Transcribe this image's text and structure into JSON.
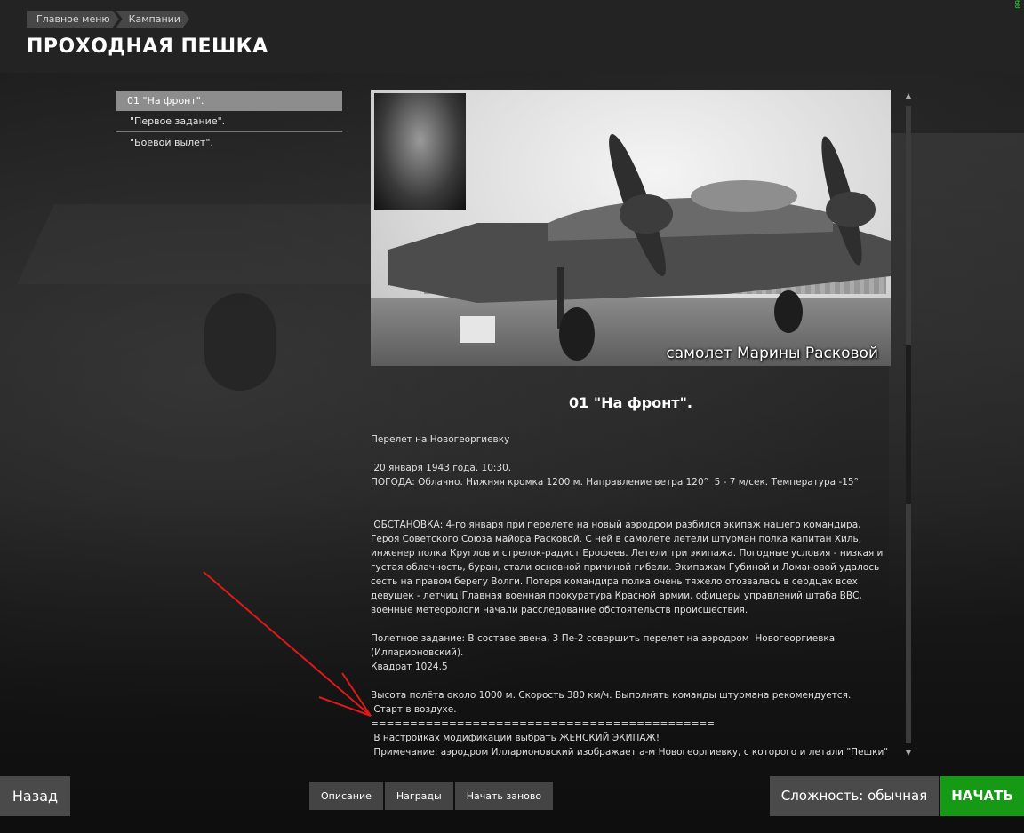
{
  "breadcrumb": [
    "Главное меню",
    "Кампании"
  ],
  "page_title": "ПРОХОДНАЯ ПЕШКА",
  "fps_counter": "60",
  "missions": [
    {
      "label": "01 \"На фронт\".",
      "active": true
    },
    {
      "label": "\"Первое задание\".",
      "active": false
    },
    {
      "label": "\"Боевой вылет\".",
      "active": false
    }
  ],
  "photo": {
    "caption": "самолет Марины Расковой"
  },
  "mission_heading": "01 \"На фронт\".",
  "description": [
    "Перелет на Новогеоргиевку",
    "",
    " 20 января 1943 года. 10:30.\nПОГОДА: Облачно. Нижняя кромка 1200 м. Направление ветра 120°  5 - 7 м/сек. Температура -15°",
    "",
    "",
    " ОБСТАНОВКА: 4-го января при перелете на новый аэродром разбился экипаж нашего командира, Героя Советского Союза майора Расковой. С ней в самолете летели штурман полка капитан Хиль, инженер полка Круглов и стрелок-радист Ерофеев. Летели три экипажа. Погодные условия - низкая и густая облачность, буран, стали основной причиной гибели. Экипажам Губиной и Ломановой удалось сесть на правом берегу Волги. Потеря командира полка очень тяжело отозвалась в сердцах всех девушек - летчиц!Главная военная прокуратура Красной армии, офицеры управлений штаба ВВС, военные метеорологи начали расследование обстоятельств происшествия.",
    "",
    "Полетное задание: В составе звена, 3 Пе-2 совершить перелет на аэродром  Новогеоргиевка (Илларионовский).\nКвадрат 1024.5",
    "",
    "Высота полёта около 1000 м. Скорость 380 км/ч. Выполнять команды штурмана рекомендуется.\n Старт в воздухе.\n============================================\n В настройках модификаций выбрать ЖЕНСКИЙ ЭКИПАЖ!\n Примечание: аэродром Илларионовский изображает а-м Новогеоргиевку, с которого и летали \"Пешки\" (был примерно в тех местах)"
  ],
  "buttons": {
    "back": "Назад",
    "difficulty": "Сложность: обычная",
    "start": "НАЧАТЬ"
  },
  "tabs": [
    "Описание",
    "Награды",
    "Начать заново"
  ],
  "colors": {
    "accent_green": "#169a16",
    "active_item": "#8d8d8d",
    "annotation_arrow": "#e01818"
  }
}
